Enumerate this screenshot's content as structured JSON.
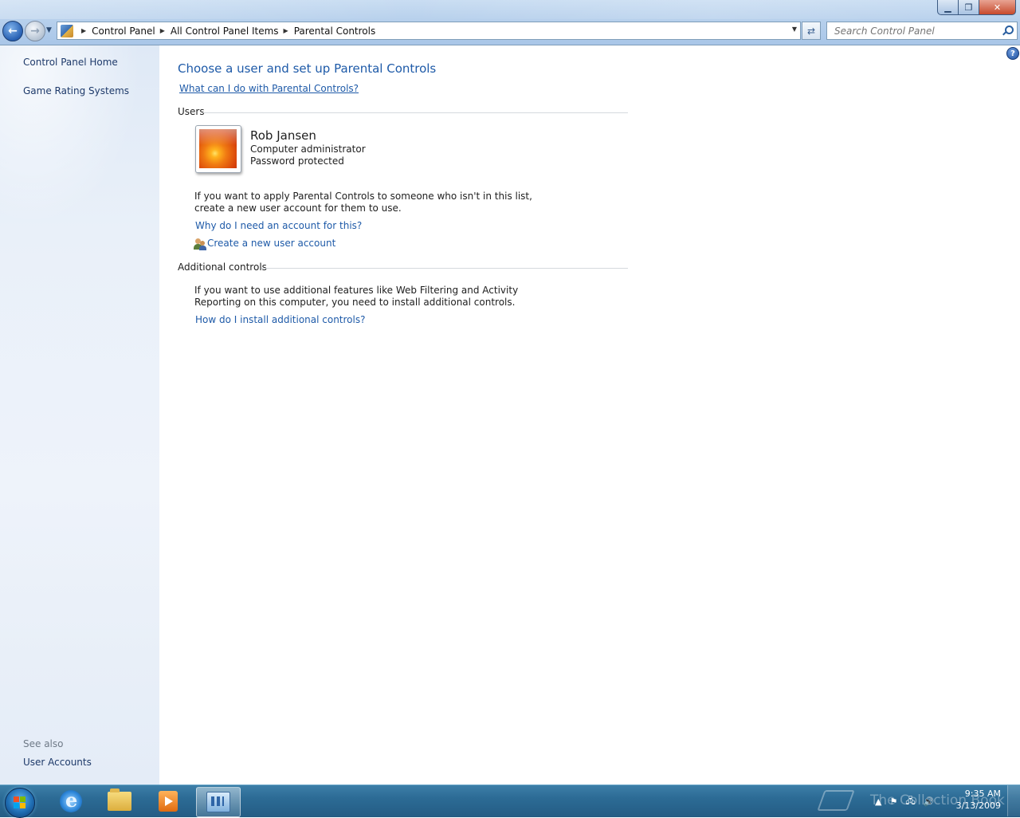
{
  "window": {
    "controls": {
      "minimize": "▁",
      "maximize": "❐",
      "close": "✕"
    }
  },
  "address": {
    "crumbs": [
      "Control Panel",
      "All Control Panel Items",
      "Parental Controls"
    ]
  },
  "search": {
    "placeholder": "Search Control Panel"
  },
  "left_pane": {
    "links": [
      "Control Panel Home",
      "Game Rating Systems"
    ],
    "see_also_heading": "See also",
    "see_also_links": [
      "User Accounts"
    ]
  },
  "main": {
    "title": "Choose a user and set up Parental Controls",
    "help_link": "What can I do with Parental Controls?",
    "users_heading": "Users",
    "user": {
      "name": "Rob Jansen",
      "role": "Computer administrator",
      "status": "Password protected"
    },
    "apply_text": [
      "If you want to apply Parental Controls to someone who isn't in this list,",
      "create a new user account for them to use."
    ],
    "why_link": "Why do I need an account for this?",
    "create_link": "Create a new user account",
    "additional_heading": "Additional controls",
    "additional_text": [
      "If you want to use additional features like Web Filtering and Activity",
      "Reporting on this computer, you need to install additional controls."
    ],
    "install_link": "How do I install additional controls?"
  },
  "taskbar": {
    "time": "9:35 AM",
    "date": "3/13/2009",
    "watermark": "The Collection Book",
    "tray_icons": [
      "▲",
      "⚑",
      "🖧",
      "🔊"
    ]
  }
}
